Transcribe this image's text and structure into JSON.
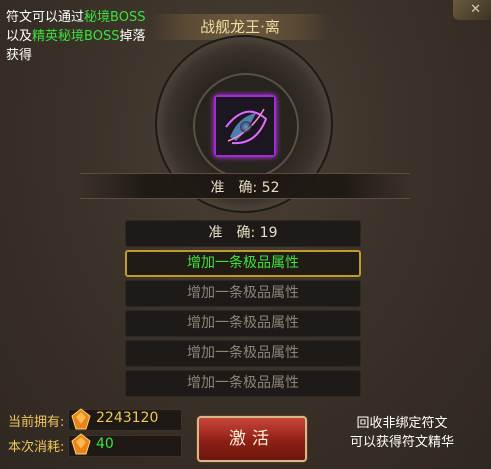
{
  "description": {
    "line1_prefix": "符文可以通过",
    "line1_highlight": "秘境BOSS",
    "line2_prefix": "以及",
    "line2_highlight": "精英秘境BOSS",
    "line2_suffix": "掉落",
    "line3": "获得"
  },
  "title": "战舰龙王·离",
  "item": {
    "icon": "rune-item-icon",
    "glow_color": "#c33cff"
  },
  "main_stat": "准　确: 52",
  "rows": {
    "accuracy": "准　确: 19",
    "attr1": "增加一条极品属性",
    "attr2": "增加一条极品属性",
    "attr3": "增加一条极品属性",
    "attr4": "增加一条极品属性",
    "attr5": "增加一条极品属性"
  },
  "resources": {
    "own_label": "当前拥有:",
    "own_value": "2243120",
    "cost_label": "本次消耗:",
    "cost_value": "40"
  },
  "activate_button": "激活",
  "hint": {
    "line1": "回收非绑定符文",
    "line2": "可以获得符文精华"
  },
  "colors": {
    "highlight_green": "#3fe13f",
    "gold": "#f0c65a",
    "selected_border": "#c29a2c"
  }
}
